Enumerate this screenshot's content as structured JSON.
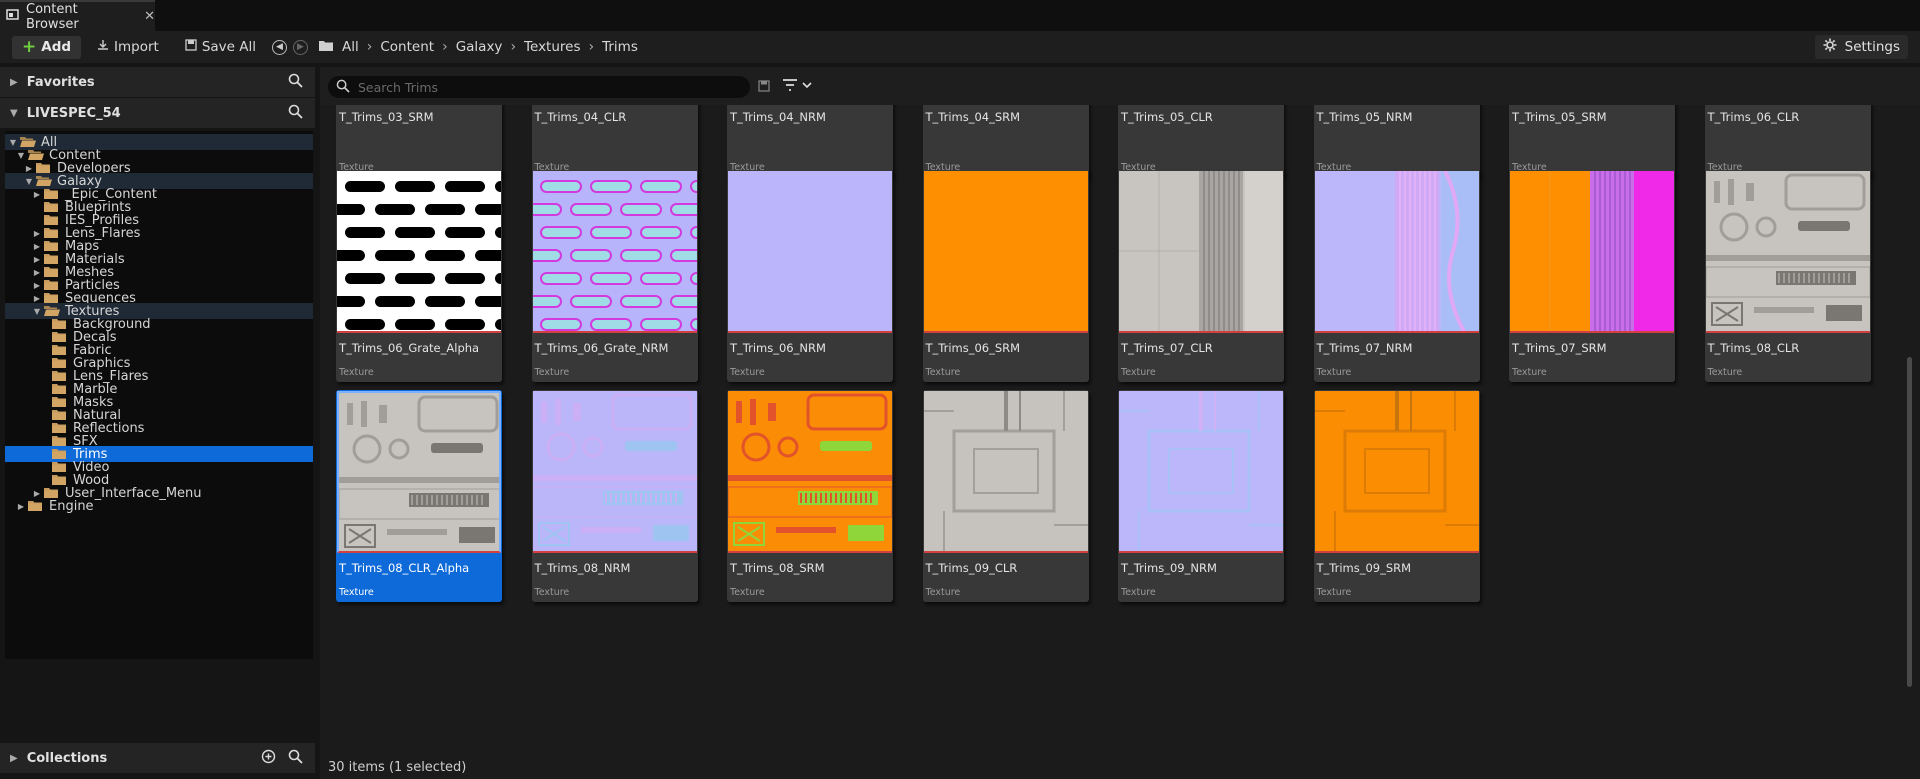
{
  "tab": {
    "title": "Content Browser",
    "close": "✕"
  },
  "toolbar": {
    "add_label": "Add",
    "import_label": "Import",
    "save_all_label": "Save All",
    "breadcrumb": [
      "All",
      "Content",
      "Galaxy",
      "Textures",
      "Trims"
    ],
    "settings_label": "Settings"
  },
  "favorites": {
    "label": "Favorites"
  },
  "project": {
    "label": "LIVESPEC_54"
  },
  "collections": {
    "label": "Collections"
  },
  "tree": [
    {
      "label": "All",
      "depth": 0,
      "expanded": true,
      "state": "hl",
      "icon": "open-folder-icon"
    },
    {
      "label": "Content",
      "depth": 1,
      "expanded": true,
      "state": "",
      "icon": "open-folder-icon"
    },
    {
      "label": "Developers",
      "depth": 2,
      "expanded": false,
      "state": "",
      "icon": "folder-icon"
    },
    {
      "label": "Galaxy",
      "depth": 2,
      "expanded": true,
      "state": "hl",
      "icon": "open-folder-icon"
    },
    {
      "label": "_Epic_Content",
      "depth": 3,
      "expanded": false,
      "state": "",
      "icon": "folder-icon"
    },
    {
      "label": "Blueprints",
      "depth": 3,
      "expanded": null,
      "state": "",
      "icon": "folder-icon"
    },
    {
      "label": "IES_Profiles",
      "depth": 3,
      "expanded": null,
      "state": "",
      "icon": "folder-icon"
    },
    {
      "label": "Lens_Flares",
      "depth": 3,
      "expanded": false,
      "state": "",
      "icon": "folder-icon"
    },
    {
      "label": "Maps",
      "depth": 3,
      "expanded": false,
      "state": "",
      "icon": "folder-icon"
    },
    {
      "label": "Materials",
      "depth": 3,
      "expanded": false,
      "state": "",
      "icon": "folder-icon"
    },
    {
      "label": "Meshes",
      "depth": 3,
      "expanded": false,
      "state": "",
      "icon": "folder-icon"
    },
    {
      "label": "Particles",
      "depth": 3,
      "expanded": false,
      "state": "",
      "icon": "folder-icon"
    },
    {
      "label": "Sequences",
      "depth": 3,
      "expanded": false,
      "state": "",
      "icon": "folder-icon"
    },
    {
      "label": "Textures",
      "depth": 3,
      "expanded": true,
      "state": "hl",
      "icon": "open-folder-icon"
    },
    {
      "label": "Background",
      "depth": 4,
      "expanded": null,
      "state": "",
      "icon": "folder-icon"
    },
    {
      "label": "Decals",
      "depth": 4,
      "expanded": null,
      "state": "",
      "icon": "folder-icon"
    },
    {
      "label": "Fabric",
      "depth": 4,
      "expanded": null,
      "state": "",
      "icon": "folder-icon"
    },
    {
      "label": "Graphics",
      "depth": 4,
      "expanded": null,
      "state": "",
      "icon": "folder-icon"
    },
    {
      "label": "Lens_Flares",
      "depth": 4,
      "expanded": null,
      "state": "",
      "icon": "folder-icon"
    },
    {
      "label": "Marble",
      "depth": 4,
      "expanded": null,
      "state": "",
      "icon": "folder-icon"
    },
    {
      "label": "Masks",
      "depth": 4,
      "expanded": null,
      "state": "",
      "icon": "folder-icon"
    },
    {
      "label": "Natural",
      "depth": 4,
      "expanded": null,
      "state": "",
      "icon": "folder-icon"
    },
    {
      "label": "Reflections",
      "depth": 4,
      "expanded": null,
      "state": "",
      "icon": "folder-icon"
    },
    {
      "label": "SFX",
      "depth": 4,
      "expanded": null,
      "state": "",
      "icon": "folder-icon"
    },
    {
      "label": "Trims",
      "depth": 4,
      "expanded": null,
      "state": "sel",
      "icon": "folder-icon"
    },
    {
      "label": "Video",
      "depth": 4,
      "expanded": null,
      "state": "",
      "icon": "folder-icon"
    },
    {
      "label": "Wood",
      "depth": 4,
      "expanded": null,
      "state": "",
      "icon": "folder-icon"
    },
    {
      "label": "User_Interface_Menu",
      "depth": 3,
      "expanded": false,
      "state": "",
      "icon": "folder-icon"
    },
    {
      "label": "Engine",
      "depth": 1,
      "expanded": false,
      "state": "",
      "icon": "folder-icon"
    }
  ],
  "search": {
    "placeholder": "Search Trims",
    "value": ""
  },
  "asset_type_label": "Texture",
  "assets_partial_row": [
    "T_Trims_03_SRM",
    "T_Trims_04_CLR",
    "T_Trims_04_NRM",
    "T_Trims_04_SRM",
    "T_Trims_05_CLR",
    "T_Trims_05_NRM",
    "T_Trims_05_SRM",
    "T_Trims_06_CLR"
  ],
  "assets": [
    {
      "name": "T_Trims_06_Grate_Alpha",
      "kind": "grate_alpha",
      "selected": false
    },
    {
      "name": "T_Trims_06_Grate_NRM",
      "kind": "grate_nrm",
      "selected": false
    },
    {
      "name": "T_Trims_06_NRM",
      "kind": "flat_nrm",
      "selected": false
    },
    {
      "name": "T_Trims_06_SRM",
      "kind": "flat_srm",
      "selected": false
    },
    {
      "name": "T_Trims_07_CLR",
      "kind": "clr07",
      "selected": false
    },
    {
      "name": "T_Trims_07_NRM",
      "kind": "nrm07",
      "selected": false
    },
    {
      "name": "T_Trims_07_SRM",
      "kind": "srm07",
      "selected": false
    },
    {
      "name": "T_Trims_08_CLR",
      "kind": "clr08",
      "selected": false
    },
    {
      "name": "T_Trims_08_CLR_Alpha",
      "kind": "clr08",
      "selected": true
    },
    {
      "name": "T_Trims_08_NRM",
      "kind": "nrm08",
      "selected": false
    },
    {
      "name": "T_Trims_08_SRM",
      "kind": "srm08",
      "selected": false
    },
    {
      "name": "T_Trims_09_CLR",
      "kind": "clr09",
      "selected": false
    },
    {
      "name": "T_Trims_09_NRM",
      "kind": "nrm09",
      "selected": false
    },
    {
      "name": "T_Trims_09_SRM",
      "kind": "srm09",
      "selected": false
    }
  ],
  "status": "30 items (1 selected)",
  "colors": {
    "selection": "#0e6ad8",
    "tile_bg": "#383838",
    "texture_underline": "#d24040",
    "add_plus": "#6fcf3f",
    "normal_map": "#b8b4fb",
    "srm_orange": "#fe8f00"
  }
}
